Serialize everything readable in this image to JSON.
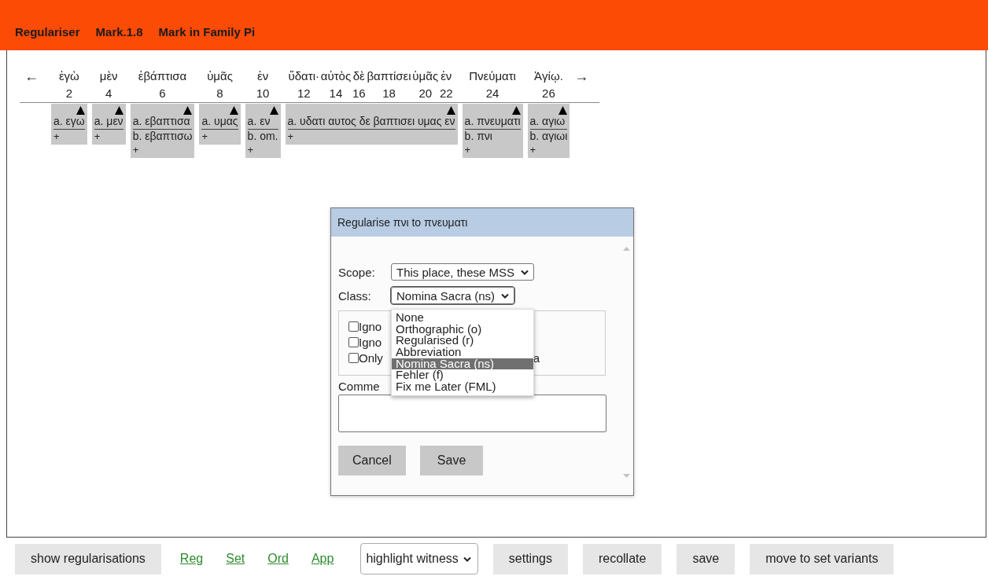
{
  "header": {
    "items": [
      "Regulariser",
      "Mark.1.8",
      "Mark in Family Pi"
    ]
  },
  "collation": {
    "prev_arrow": "←",
    "next_arrow": "→",
    "units": [
      {
        "words": [
          {
            "text": "ἐγὼ",
            "index": "2"
          }
        ],
        "readings": [
          "a. εγω"
        ],
        "add": "+"
      },
      {
        "words": [
          {
            "text": "μὲν",
            "index": "4"
          }
        ],
        "readings": [
          "a. μεν"
        ],
        "add": "+"
      },
      {
        "words": [
          {
            "text": "ἐβάπτισα",
            "index": "6"
          }
        ],
        "readings": [
          "a. εβαπτισα",
          "b. εβαπτισω"
        ],
        "add": "+"
      },
      {
        "words": [
          {
            "text": "ὑμᾶς",
            "index": "8"
          }
        ],
        "readings": [
          "a. υμας"
        ],
        "add": "+"
      },
      {
        "words": [
          {
            "text": "ἐν",
            "index": "10"
          }
        ],
        "readings": [
          "a. εν",
          "b. om."
        ],
        "add": "+"
      },
      {
        "words": [
          {
            "text": "ὕδατι·",
            "index": "12"
          },
          {
            "text": "αὐτὸς",
            "index": "14"
          },
          {
            "text": "δὲ",
            "index": "16"
          },
          {
            "text": "βαπτίσει",
            "index": "18"
          },
          {
            "text": "ὑμᾶς",
            "index": "20"
          },
          {
            "text": "ἐν",
            "index": "22"
          }
        ],
        "readings": [
          "a. υδατι αυτος δε βαπτισει υμας εν"
        ],
        "add": "+"
      },
      {
        "words": [
          {
            "text": "Πνεύματι",
            "index": "24"
          }
        ],
        "readings": [
          "a. πνευματι",
          "b. πνι"
        ],
        "add": "+"
      },
      {
        "words": [
          {
            "text": "Ἁγίῳ.",
            "index": "26"
          }
        ],
        "readings": [
          "a. αγιω",
          "b. αγιωι"
        ],
        "add": "+"
      }
    ]
  },
  "dialog": {
    "title": "Regularise πνι to πνευματι",
    "fields": [
      {
        "label": "Scope:",
        "value": "This place, these MSS",
        "expanded": false
      },
      {
        "label": "Class:",
        "value": "Nomina Sacra (ns)",
        "expanded": true
      }
    ],
    "class_options": [
      {
        "label": "None",
        "selected": false
      },
      {
        "label": "Orthographic (o)",
        "selected": false
      },
      {
        "label": "Regularised (r)",
        "selected": false
      },
      {
        "label": "Abbreviation",
        "selected": false
      },
      {
        "label": "Nomina Sacra (ns)",
        "selected": true
      },
      {
        "label": "Fehler (f)",
        "selected": false
      },
      {
        "label": "Fix me Later (FML)",
        "selected": false
      }
    ],
    "checkboxes": [
      {
        "label": "Igno",
        "checked": false
      },
      {
        "label": "Igno",
        "checked": false
      },
      {
        "label": "Only",
        "checked": false,
        "trailing_text": "a"
      }
    ],
    "comment_label": "Comme",
    "buttons": [
      "Cancel",
      "Save"
    ]
  },
  "footer": {
    "items": [
      {
        "kind": "button",
        "label": "show regularisations"
      },
      {
        "kind": "link",
        "label": "Reg"
      },
      {
        "kind": "link",
        "label": "Set"
      },
      {
        "kind": "link",
        "label": "Ord"
      },
      {
        "kind": "link",
        "label": "App"
      },
      {
        "kind": "select",
        "label": "highlight witness"
      },
      {
        "kind": "button",
        "label": "settings"
      },
      {
        "kind": "button",
        "label": "recollate"
      },
      {
        "kind": "button",
        "label": "save"
      },
      {
        "kind": "button",
        "label": "move to set variants"
      }
    ]
  }
}
